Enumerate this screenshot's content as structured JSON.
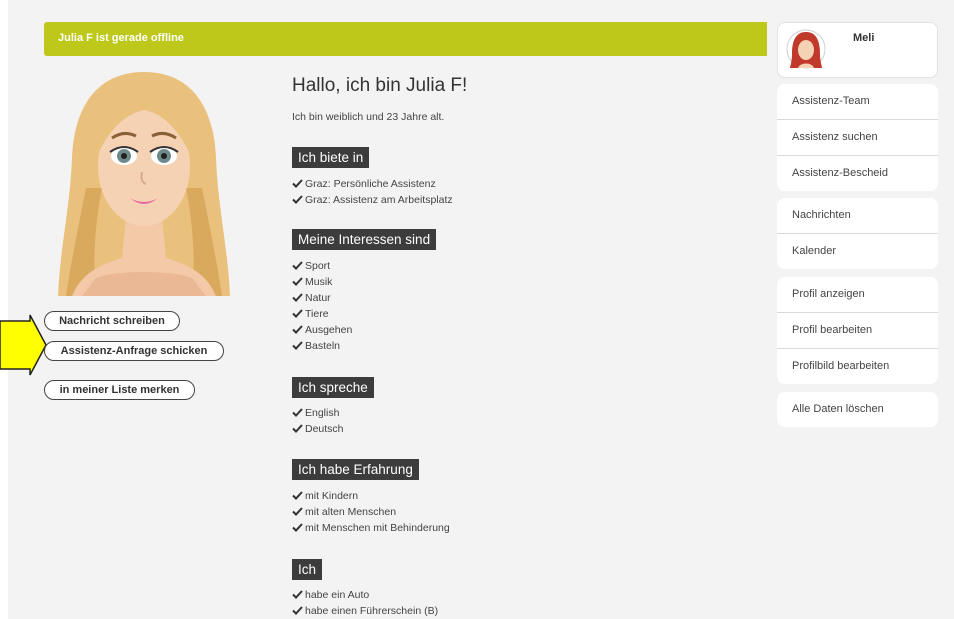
{
  "status_bar": {
    "text": "Julia F ist gerade offline"
  },
  "profile": {
    "greeting": "Hallo, ich bin Julia F!",
    "intro": "Ich bin weiblich und 23 Jahre alt.",
    "sections": [
      {
        "heading": "Ich biete in",
        "items": [
          "Graz: Persönliche Assistenz",
          "Graz: Assistenz am Arbeitsplatz"
        ]
      },
      {
        "heading": "Meine Interessen sind",
        "items": [
          "Sport",
          "Musik",
          "Natur",
          "Tiere",
          "Ausgehen",
          "Basteln"
        ]
      },
      {
        "heading": "Ich spreche",
        "items": [
          "English",
          "Deutsch"
        ]
      },
      {
        "heading": "Ich habe Erfahrung",
        "items": [
          "mit Kindern",
          "mit alten Menschen",
          "mit Menschen mit Behinderung"
        ]
      },
      {
        "heading": "Ich",
        "items": [
          "habe ein Auto",
          "habe einen Führerschein (B)"
        ]
      }
    ]
  },
  "actions": {
    "message": "Nachricht schreiben",
    "request": "Assistenz-Anfrage schicken",
    "save": "in meiner Liste merken"
  },
  "sidebar": {
    "user_name": "Meli",
    "groups": [
      [
        "Assistenz-Team",
        "Assistenz suchen",
        "Assistenz-Bescheid"
      ],
      [
        "Nachrichten",
        "Kalender"
      ],
      [
        "Profil anzeigen",
        "Profil bearbeiten",
        "Profilbild bearbeiten"
      ],
      [
        "Alle Daten löschen"
      ]
    ]
  },
  "colors": {
    "status_bar": "#bdc81a",
    "section_heading_bg": "#3c3c3c",
    "pointer_arrow": "#ffff00"
  },
  "icons": [
    "check-icon",
    "pointer-arrow",
    "user-avatar",
    "profile-avatar"
  ]
}
